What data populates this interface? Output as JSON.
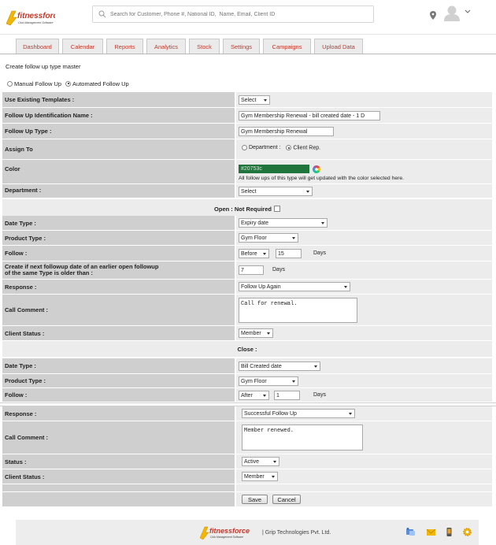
{
  "brand": {
    "name": "fitnessforce",
    "tagline": "Club Management Software"
  },
  "search": {
    "placeholder": "Search for Customer, Phone #, National ID,  Name, Email, Client ID"
  },
  "tabs": [
    "Dashboard",
    "Calendar",
    "Reports",
    "Analytics",
    "Stock",
    "Settings",
    "Campaigns",
    "Upload Data"
  ],
  "page": {
    "title": "Create follow up type master"
  },
  "mode": {
    "manual_label": "Manual Follow Up",
    "automated_label": "Automated Follow Up",
    "selected": "automated"
  },
  "fields": {
    "existing_templates": {
      "label": "Use Existing Templates :",
      "value": "Select"
    },
    "identification_name": {
      "label": "Follow Up Identification Name :",
      "value": "Gym Membership Renewal - bill created date - 1 D"
    },
    "follow_up_type": {
      "label": "Follow Up Type :",
      "value": "Gym Membership Renewal"
    },
    "assign_to": {
      "label": "Assign To",
      "option_department": "Department :",
      "option_client_rep": "Client Rep.",
      "selected": "client_rep"
    },
    "color": {
      "label": "Color",
      "value": "#20753c",
      "hint": "All follow ups of this type will get updated with the color selected here."
    },
    "department": {
      "label": "Department :",
      "value": "Select"
    }
  },
  "open": {
    "heading": "Open : Not Required",
    "date_type": {
      "label": "Date Type :",
      "value": "Expiry date"
    },
    "product_type": {
      "label": "Product Type :",
      "value": "Gym Floor"
    },
    "follow": {
      "label": "Follow :",
      "when": "Before",
      "count": "15",
      "unit": "Days"
    },
    "create_if": {
      "label_line1": "Create if next followup date of an earlier open followup",
      "label_line2": "of the same Type is older than :",
      "count": "7",
      "unit": "Days"
    },
    "response": {
      "label": "Response :",
      "value": "Follow Up Again"
    },
    "call_comment": {
      "label": "Call Comment :",
      "value": "Call for renewal."
    },
    "client_status": {
      "label": "Client Status :",
      "value": "Member"
    }
  },
  "close": {
    "heading": "Close :",
    "date_type": {
      "label": "Date Type :",
      "value": "Bill Created date"
    },
    "product_type": {
      "label": "Product Type :",
      "value": "Gym Floor"
    },
    "follow": {
      "label": "Follow :",
      "when": "After",
      "count": "1",
      "unit": "Days"
    },
    "response": {
      "label": "Response :",
      "value": "Successful Follow Up"
    },
    "call_comment": {
      "label": "Call Comment :",
      "value": "Member renewed."
    },
    "status": {
      "label": "Status :",
      "value": "Active"
    },
    "client_status": {
      "label": "Client Status :",
      "value": "Member"
    }
  },
  "actions": {
    "save": "Save",
    "cancel": "Cancel"
  },
  "footer": {
    "company": "| Grip Technologies Pvt. Ltd."
  },
  "colors": {
    "tab_text": "#c0392b",
    "label_bg": "#cfcfcf",
    "value_bg": "#ececec",
    "brand_yellow": "#f2b705"
  }
}
